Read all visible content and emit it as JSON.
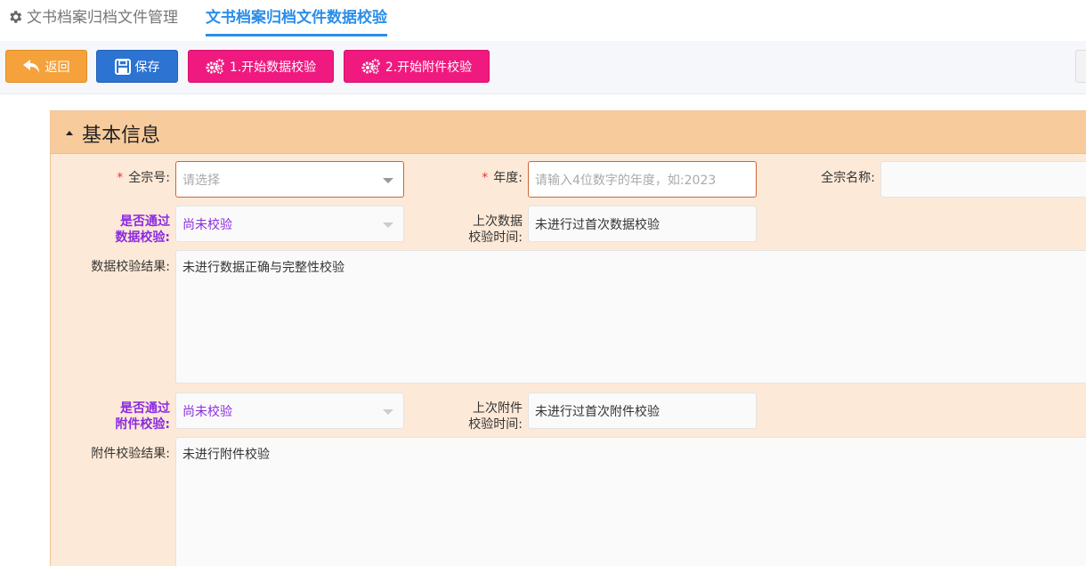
{
  "tabs": [
    {
      "label": "文书档案归档文件管理",
      "icon": "gear-icon"
    },
    {
      "label": "文书档案归档文件数据校验",
      "active": true
    }
  ],
  "toolbar": {
    "back_label": "返回",
    "save_label": "保存",
    "check_data_label": "1.开始数据校验",
    "check_attach_label": "2.开始附件校验"
  },
  "panel": {
    "title": "基本信息",
    "fields": {
      "fonds_no": {
        "label": "全宗号:",
        "placeholder": "请选择",
        "required_mark": "*"
      },
      "year": {
        "label": "年度:",
        "placeholder": "请输入4位数字的年度，如:2023",
        "required_mark": "*"
      },
      "fonds_name": {
        "label": "全宗名称:",
        "value": ""
      },
      "data_passed": {
        "label_line1": "是否通过",
        "label_line2": "数据校验:",
        "value": "尚未校验"
      },
      "last_data_check": {
        "label_line1": "上次数据",
        "label_line2": "校验时间:",
        "value": "未进行过首次数据校验"
      },
      "data_result": {
        "label": "数据校验结果:",
        "value": "未进行数据正确与完整性校验"
      },
      "attach_passed": {
        "label_line1": "是否通过",
        "label_line2": "附件校验:",
        "value": "尚未校验"
      },
      "last_attach_check": {
        "label_line1": "上次附件",
        "label_line2": "校验时间:",
        "value": "未进行过首次附件校验"
      },
      "attach_result": {
        "label": "附件校验结果:",
        "value": "未进行附件校验"
      }
    }
  },
  "colors": {
    "accent": "#2b8ee8",
    "back_button": "#f5a23c",
    "save_button": "#2c73d2",
    "check_button": "#f0197f",
    "panel_header": "#f8cb9c",
    "panel_body": "#fde9d7",
    "purple_label": "#8a2be2",
    "required": "#e33333"
  }
}
